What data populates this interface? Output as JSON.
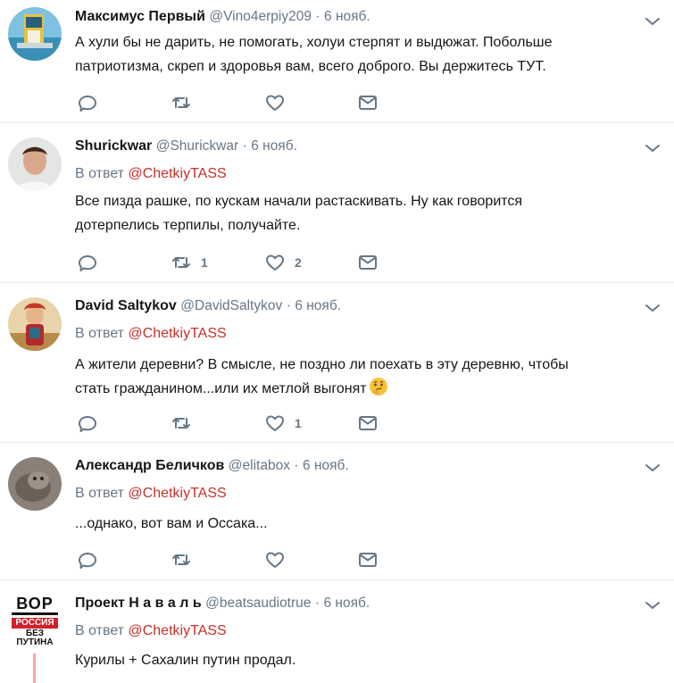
{
  "tweets": [
    {
      "name": "Максимус Первый",
      "handle": "@Vino4erpiy209",
      "time": "6 нояб.",
      "reply_prefix": "",
      "reply_mention": "",
      "lines": [
        "А хули бы не дарить, не помогать, холуи стерпят и выдюжат. Побольше",
        "патриотизма, скреп и здоровья вам, всего доброго. Вы держитесь ТУТ."
      ],
      "retweets": "",
      "likes": ""
    },
    {
      "name": "Shurickwar",
      "handle": "@Shurickwar",
      "time": "6 нояб.",
      "reply_prefix": "В ответ",
      "reply_mention": "@ChetkiyTASS",
      "lines": [
        "Все пизда рашке, по кускам начали растаскивать. Ну как говорится",
        "дотерпелись терпилы, получайте."
      ],
      "retweets": "1",
      "likes": "2"
    },
    {
      "name": "David Saltykov",
      "handle": "@DavidSaltykov",
      "time": "6 нояб.",
      "reply_prefix": "В ответ",
      "reply_mention": "@ChetkiyTASS",
      "lines": [
        "А жители деревни? В смысле, не поздно ли поехать в эту деревню, чтобы",
        "стать гражданином...или их метлой выгонят"
      ],
      "emoji": "thinking-face",
      "retweets": "",
      "likes": "1"
    },
    {
      "name": "Александр Беличков",
      "handle": "@elitabox",
      "time": "6 нояб.",
      "reply_prefix": "В ответ",
      "reply_mention": "@ChetkiyTASS",
      "lines": [
        "...однако, вот вам и Оссака..."
      ],
      "retweets": "",
      "likes": ""
    },
    {
      "name": "Проект Н а в а л ь",
      "handle": "@beatsaudiotrue",
      "time": "6 нояб.",
      "reply_prefix": "В ответ",
      "reply_mention": "@ChetkiyTASS",
      "lines": [
        "Курилы + Сахалин путин продал."
      ],
      "retweets": "",
      "likes": ""
    }
  ],
  "avatar5": {
    "top": "ВОР",
    "middle": "РОССИЯ",
    "bottom1": "БЕЗ",
    "bottom2": "ПУТИНА"
  },
  "sep": "·",
  "colors": {
    "accent": "#c4302b",
    "muted": "#657786",
    "thread": "#f5a4a9"
  }
}
